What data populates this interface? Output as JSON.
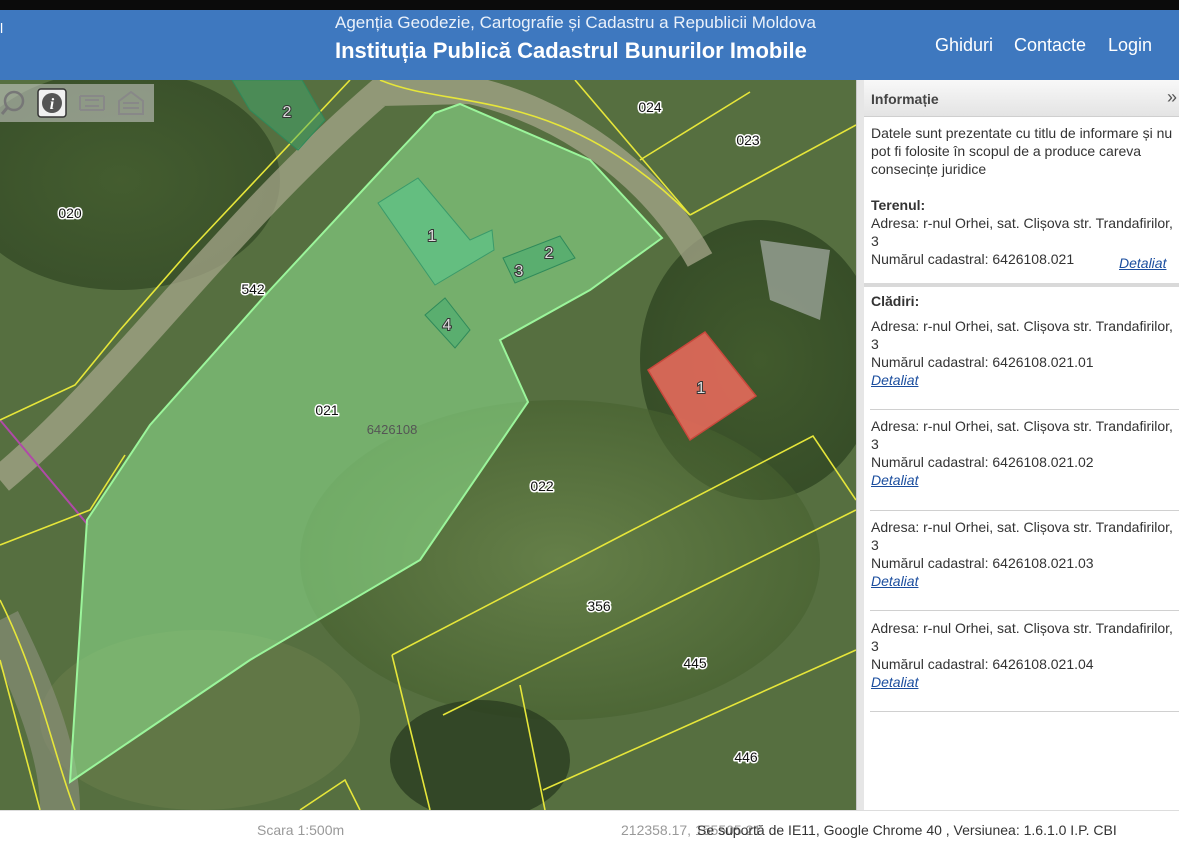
{
  "header": {
    "agency": "Agenția Geodezie, Cartografie și Cadastru a Republicii Moldova",
    "institution": "Instituția Publică Cadastrul Bunurilor Imobile",
    "nav": [
      "Ghiduri",
      "Contacte",
      "Login"
    ],
    "left_fragment": "l",
    "background_color": "#3e78bf"
  },
  "toolbar": {
    "tools": [
      "zoom-icon",
      "info-icon",
      "bridge-icon",
      "building-icon"
    ],
    "active": "info-icon"
  },
  "map": {
    "parcel_labels": [
      "024",
      "023",
      "020",
      "542",
      "021",
      "022",
      "356",
      "445",
      "446"
    ],
    "cadastral_zone": "6426108",
    "building_labels": [
      "2",
      "1",
      "3",
      "2",
      "4",
      "1"
    ],
    "colors": {
      "selected_parcel": "#8fe38f",
      "parcel_boundary": "#e6e63a",
      "building": "#3fae72",
      "selected_building": "#ee6b5e"
    }
  },
  "panel": {
    "title": "Informație",
    "collapse_icon": "»",
    "notice": "Datele sunt prezentate cu titlu de informare și nu pot fi folosite în scopul de a produce careva consecințe juridice",
    "teren": {
      "title": "Terenul:",
      "address": "Adresa: r-nul Orhei, sat. Clișova str. Trandafirilor, 3",
      "cadastral": "Numărul cadastral: 6426108.021",
      "link": "Detaliat"
    },
    "cladiri_title": "Clădiri:",
    "buildings": [
      {
        "address": "Adresa: r-nul Orhei, sat. Clișova str. Trandafirilor, 3",
        "cadastral": "Numărul cadastral: 6426108.021.01",
        "link": "Detaliat"
      },
      {
        "address": "Adresa: r-nul Orhei, sat. Clișova str. Trandafirilor, 3",
        "cadastral": "Numărul cadastral: 6426108.021.02",
        "link": "Detaliat"
      },
      {
        "address": "Adresa: r-nul Orhei, sat. Clișova str. Trandafirilor, 3",
        "cadastral": "Numărul cadastral: 6426108.021.03",
        "link": "Detaliat"
      },
      {
        "address": "Adresa: r-nul Orhei, sat. Clișova str. Trandafirilor, 3",
        "cadastral": "Numărul cadastral: 6426108.021.04",
        "link": "Detaliat"
      }
    ]
  },
  "footer": {
    "scale": "Scara 1:500m",
    "coords": "212358.17, 155505.21",
    "support": "Se suportă de IE11, Google Chrome 40 , Versiunea: 1.6.1.0 I.P. CBI"
  }
}
